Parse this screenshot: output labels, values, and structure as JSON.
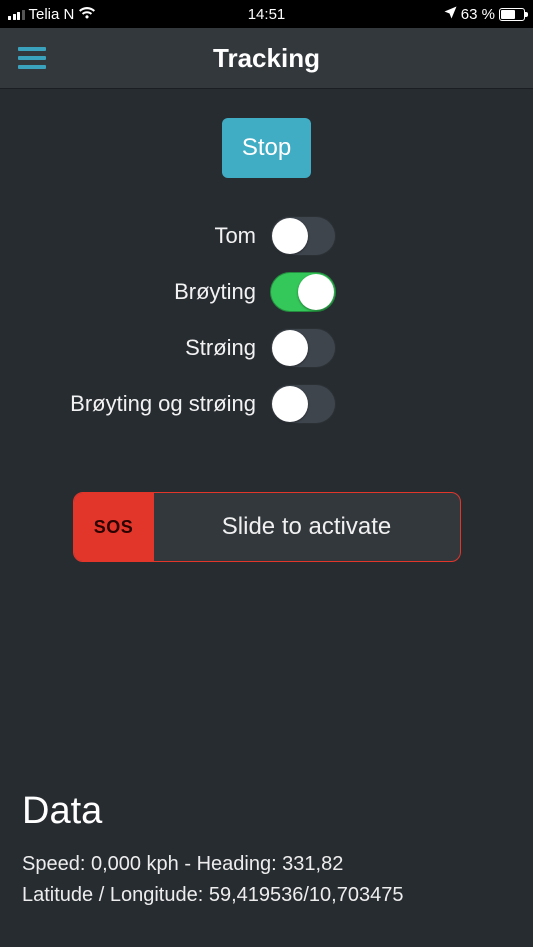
{
  "statusbar": {
    "carrier": "Telia N",
    "time": "14:51",
    "battery_pct_text": "63 %",
    "battery_fill_pct": 63
  },
  "header": {
    "title": "Tracking"
  },
  "main": {
    "stop_label": "Stop",
    "toggles": [
      {
        "label": "Tom",
        "on": false
      },
      {
        "label": "Brøyting",
        "on": true
      },
      {
        "label": "Strøing",
        "on": false
      },
      {
        "label": "Brøyting og strøing",
        "on": false
      }
    ],
    "sos": {
      "handle_label": "SOS",
      "track_label": "Slide to activate"
    }
  },
  "data_section": {
    "heading": "Data",
    "line1": "Speed: 0,000 kph - Heading: 331,82",
    "line2": "Latitude / Longitude: 59,419536/10,703475"
  }
}
